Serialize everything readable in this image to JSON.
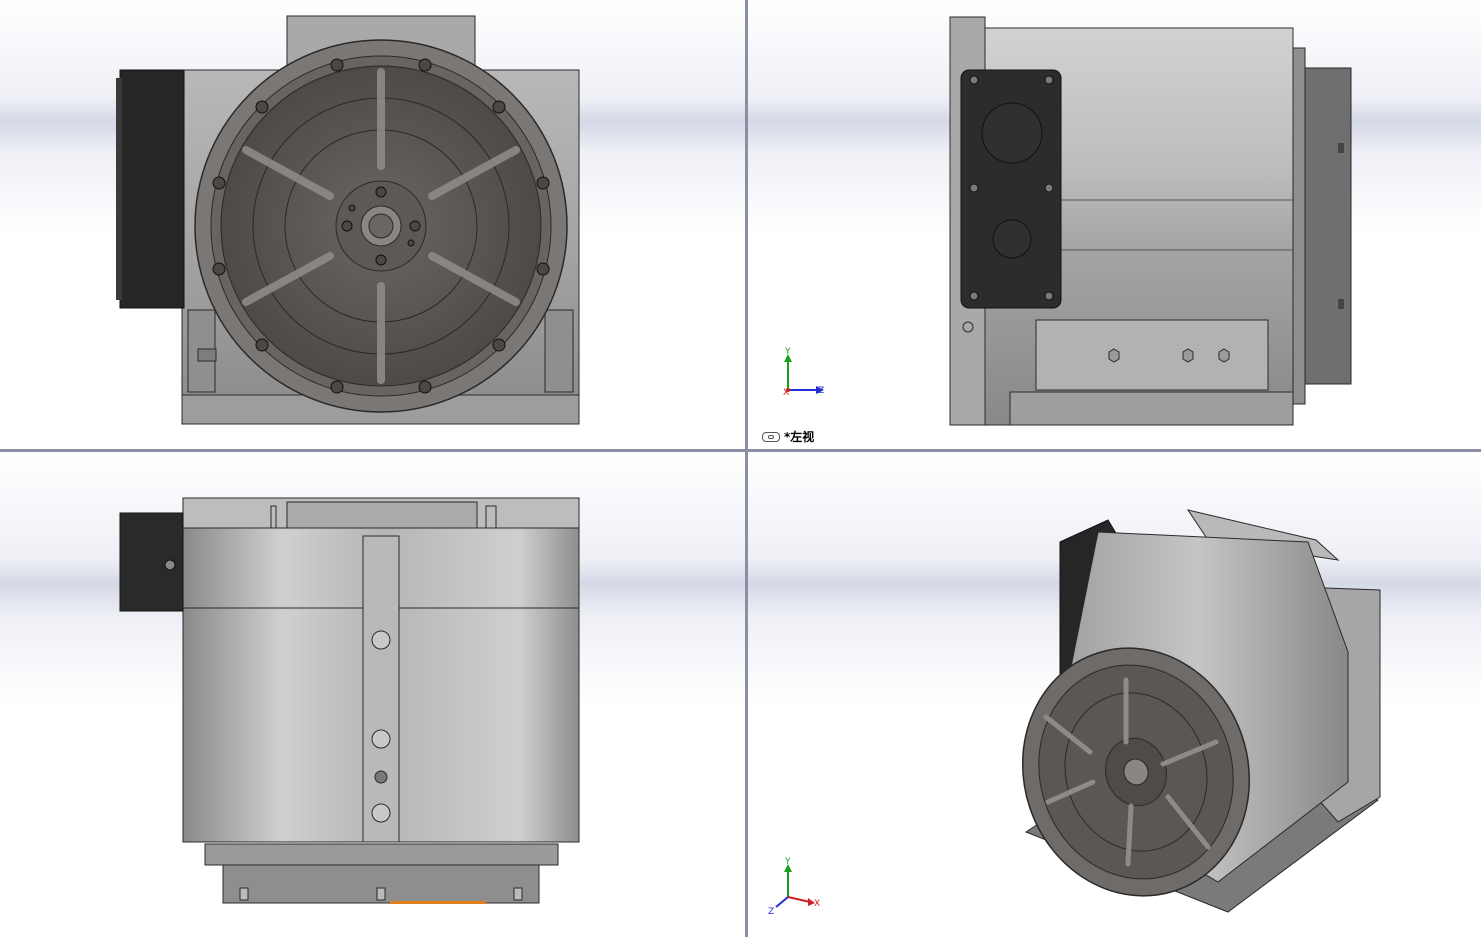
{
  "viewports": {
    "front": {
      "name": "front-view"
    },
    "left": {
      "name": "left-view",
      "label": "*左视"
    },
    "bottom": {
      "name": "bottom-view"
    },
    "iso": {
      "name": "isometric-view"
    }
  },
  "triad": {
    "x": "X",
    "y": "Y",
    "z": "Z"
  },
  "colors": {
    "metal_light": "#c9c9c9",
    "metal_mid": "#9a9a9a",
    "metal_dark": "#5f5c5a",
    "motor": "#262626",
    "outline": "#2a2a2a",
    "accent_orange": "#e0801c"
  }
}
